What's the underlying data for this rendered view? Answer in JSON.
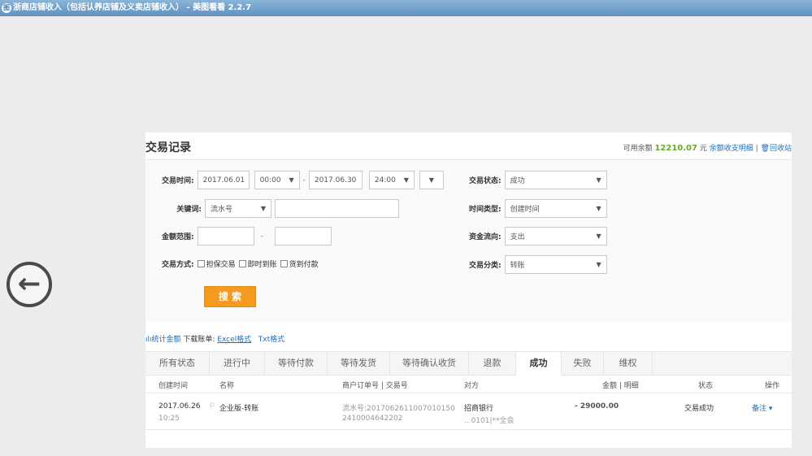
{
  "window": {
    "title": "浙商店铺收入（包括认养店铺及义卖店铺收入） - 美图看看 2.2.7",
    "icon": "app-icon"
  },
  "nav": {
    "back_icon": "arrow-left-icon",
    "back_glyph": "←"
  },
  "header": {
    "title": "交易记录",
    "balance_label": "可用余额",
    "balance_value": "12210.07",
    "balance_unit": "元",
    "detail_link": "余额收支明细",
    "separator": "|",
    "recycle_link": "回收站"
  },
  "filters": {
    "time_label": "交易时间:",
    "start_date": "2017.06.01",
    "start_time": "00:00",
    "range_dash": "-",
    "end_date": "2017.06.30",
    "end_time": "24:00",
    "keyword_label": "关键词:",
    "keyword_type": "流水号",
    "keyword_value": "",
    "amount_label": "金额范围:",
    "amount_min": "",
    "amount_max": "",
    "method_label": "交易方式:",
    "methods": [
      "担保交易",
      "即时到账",
      "货到付款"
    ],
    "status_label": "交易状态:",
    "status_value": "成功",
    "timetype_label": "时间类型:",
    "timetype_value": "创建时间",
    "flow_label": "资金流向:",
    "flow_value": "支出",
    "category_label": "交易分类:",
    "category_value": "转账",
    "search_button": "搜 索"
  },
  "export": {
    "stats_link": "统计金额",
    "download_label": "下载账单:",
    "excel_link": "Excel格式",
    "txt_link": "Txt格式"
  },
  "tabs": [
    {
      "label": "所有状态",
      "active": false
    },
    {
      "label": "进行中",
      "active": false
    },
    {
      "label": "等待付款",
      "active": false
    },
    {
      "label": "等待发货",
      "active": false
    },
    {
      "label": "等待确认收货",
      "active": false
    },
    {
      "label": "退款",
      "active": false
    },
    {
      "label": "成功",
      "active": true
    },
    {
      "label": "失败",
      "active": false
    },
    {
      "label": "维权",
      "active": false
    }
  ],
  "table": {
    "columns": {
      "created": "创建时间",
      "name": "名称",
      "order": "商户订单号 | 交易号",
      "party": "对方",
      "amount": "金额 | 明细",
      "status": "状态",
      "action": "操作"
    },
    "rows": [
      {
        "date": "2017.06.26",
        "time": "10:25",
        "name": "企业版-转账",
        "serial_line1": "流水号:2017062611007010150",
        "serial_line2": "2410004642202",
        "party_line1": "招商银行",
        "party_line2": "...0101|**全会",
        "amount": "- 29000.00",
        "status": "交易成功",
        "action": "备注 ▾"
      }
    ]
  }
}
